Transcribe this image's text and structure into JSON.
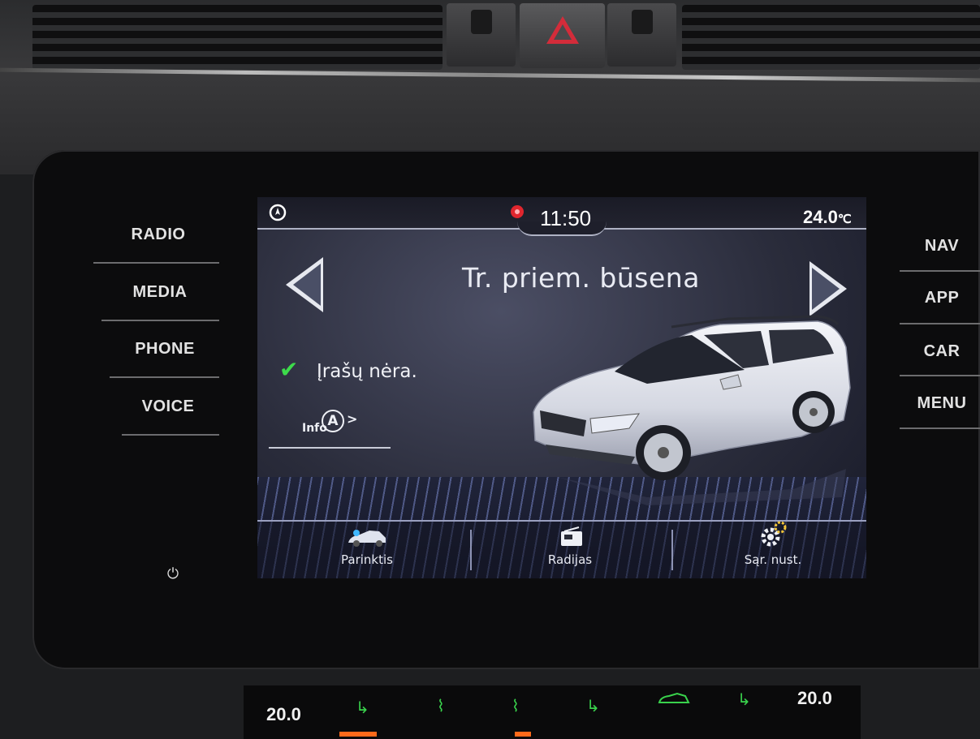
{
  "left_buttons": [
    {
      "label": "RADIO"
    },
    {
      "label": "MEDIA"
    },
    {
      "label": "PHONE"
    },
    {
      "label": "VOICE"
    }
  ],
  "right_buttons": [
    {
      "label": "NAV"
    },
    {
      "label": "APP"
    },
    {
      "label": "CAR"
    },
    {
      "label": "MENU"
    }
  ],
  "status_bar": {
    "time": "11:50",
    "temperature": "24.0",
    "temperature_unit": "℃",
    "left_icon": "compass-icon",
    "alert_icon": "alert-dot-icon"
  },
  "screen": {
    "title": "Tr. priem. būsena",
    "status_message": "Įrašų nėra.",
    "info_link": "Info",
    "info_badge": "A",
    "info_chevron": ">"
  },
  "tabs": [
    {
      "label": "Parinktis",
      "icon": "car-settings-icon"
    },
    {
      "label": "Radijas",
      "icon": "radio-icon"
    },
    {
      "label": "Sąr. nust.",
      "icon": "gear-icon"
    }
  ],
  "climate": {
    "left_temp": "20.0",
    "right_temp": "20.0"
  },
  "colors": {
    "check_green": "#3ddb4b",
    "alert_red": "#e0262e",
    "hazard_red": "#d32c3a",
    "indicator_orange": "#ff6a1a"
  }
}
